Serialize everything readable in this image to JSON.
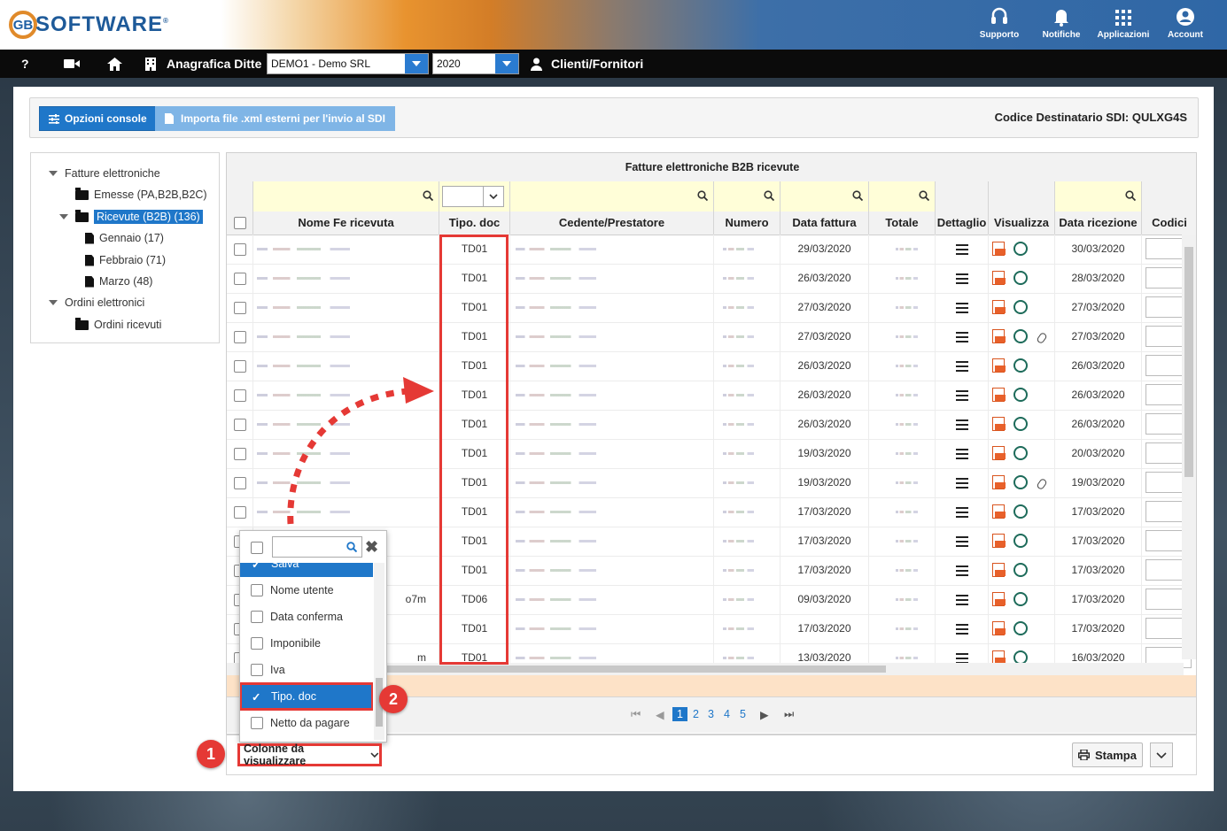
{
  "header": {
    "logo_text": "SOFTWARE",
    "logo_mark": "GB",
    "icons": [
      {
        "label": "Supporto",
        "icon": "headset-icon"
      },
      {
        "label": "Notifiche",
        "icon": "bell-icon"
      },
      {
        "label": "Applicazioni",
        "icon": "grid-icon"
      },
      {
        "label": "Account",
        "icon": "user-circle-icon"
      }
    ]
  },
  "navbar": {
    "help": "?",
    "anagrafica_label": "Anagrafica Ditte",
    "company_value": "DEMO1 - Demo SRL",
    "year_value": "2020",
    "clienti_label": "Clienti/Fornitori"
  },
  "toolbar": {
    "opzioni_label": "Opzioni console",
    "importa_label": "Importa file .xml esterni per l'invio al SDI",
    "codice_label": "Codice Destinatario SDI: QULXG4S"
  },
  "tree": {
    "fatture": "Fatture elettroniche",
    "emesse": "Emesse (PA,B2B,B2C)",
    "ricevute": "Ricevute (B2B) (136)",
    "gennaio": "Gennaio (17)",
    "febbraio": "Febbraio (71)",
    "marzo": "Marzo (48)",
    "ordini": "Ordini elettronici",
    "ordini_ricevuti": "Ordini ricevuti"
  },
  "grid": {
    "title": "Fatture elettroniche B2B ricevute",
    "columns": [
      "Nome Fe ricevuta",
      "Tipo. doc",
      "Cedente/Prestatore",
      "Numero",
      "Data fattura",
      "Totale",
      "Dettaglio",
      "Visualizza",
      "Data ricezione",
      "Codici"
    ],
    "rows": [
      {
        "tipo": "TD01",
        "data_fattura": "29/03/2020",
        "data_ricezione": "30/03/2020",
        "clip": false
      },
      {
        "tipo": "TD01",
        "data_fattura": "26/03/2020",
        "data_ricezione": "28/03/2020",
        "clip": false
      },
      {
        "tipo": "TD01",
        "data_fattura": "27/03/2020",
        "data_ricezione": "27/03/2020",
        "clip": false
      },
      {
        "tipo": "TD01",
        "data_fattura": "27/03/2020",
        "data_ricezione": "27/03/2020",
        "clip": true
      },
      {
        "tipo": "TD01",
        "data_fattura": "26/03/2020",
        "data_ricezione": "26/03/2020",
        "clip": false
      },
      {
        "tipo": "TD01",
        "data_fattura": "26/03/2020",
        "data_ricezione": "26/03/2020",
        "clip": false
      },
      {
        "tipo": "TD01",
        "data_fattura": "26/03/2020",
        "data_ricezione": "26/03/2020",
        "clip": false
      },
      {
        "tipo": "TD01",
        "data_fattura": "19/03/2020",
        "data_ricezione": "20/03/2020",
        "clip": false
      },
      {
        "tipo": "TD01",
        "data_fattura": "19/03/2020",
        "data_ricezione": "19/03/2020",
        "clip": true
      },
      {
        "tipo": "TD01",
        "data_fattura": "17/03/2020",
        "data_ricezione": "17/03/2020",
        "clip": false
      },
      {
        "tipo": "TD01",
        "data_fattura": "17/03/2020",
        "data_ricezione": "17/03/2020",
        "clip": false
      },
      {
        "tipo": "TD01",
        "data_fattura": "17/03/2020",
        "data_ricezione": "17/03/2020",
        "clip": false
      },
      {
        "tipo": "TD06",
        "data_fattura": "09/03/2020",
        "data_ricezione": "17/03/2020",
        "clip": false,
        "name_tail": "o7m"
      },
      {
        "tipo": "TD01",
        "data_fattura": "17/03/2020",
        "data_ricezione": "17/03/2020",
        "clip": false
      },
      {
        "tipo": "TD01",
        "data_fattura": "13/03/2020",
        "data_ricezione": "16/03/2020",
        "clip": false,
        "name_tail": "m"
      }
    ]
  },
  "pager": {
    "pages": [
      "1",
      "2",
      "3",
      "4",
      "5"
    ],
    "current": "1"
  },
  "column_chooser": {
    "button_label": "Colonne da visualizzare",
    "items": [
      {
        "label": "Salva",
        "checked": true
      },
      {
        "label": "Nome utente",
        "checked": false
      },
      {
        "label": "Data conferma",
        "checked": false
      },
      {
        "label": "Imponibile",
        "checked": false
      },
      {
        "label": "Iva",
        "checked": false
      },
      {
        "label": "Tipo. doc",
        "checked": true
      },
      {
        "label": "Netto da pagare",
        "checked": false
      }
    ]
  },
  "stampa_label": "Stampa",
  "callouts": {
    "one": "1",
    "two": "2"
  },
  "colors": {
    "primary": "#1f77c9",
    "highlight": "#e53935",
    "filter_bg": "#fffed8"
  }
}
